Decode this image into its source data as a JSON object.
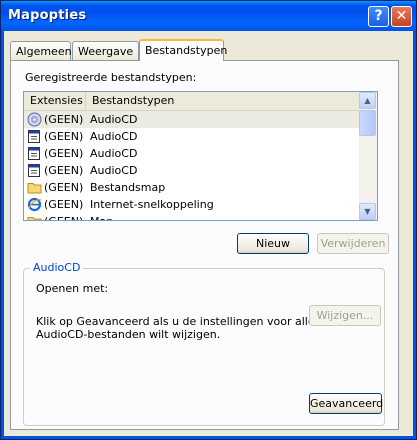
{
  "window": {
    "title": "Mapopties"
  },
  "tabs": [
    {
      "label": "Algemeen"
    },
    {
      "label": "Weergave"
    },
    {
      "label": "Bestandstypen"
    }
  ],
  "registered_label": "Geregistreerde bestandstypen:",
  "columns": [
    {
      "label": "Extensies"
    },
    {
      "label": "Bestandstypen"
    }
  ],
  "rows": [
    {
      "ext": "(GEEN)",
      "type": "AudioCD",
      "icon": "audio-cd-icon",
      "selected": true
    },
    {
      "ext": "(GEEN)",
      "type": "AudioCD",
      "icon": "app-window-icon"
    },
    {
      "ext": "(GEEN)",
      "type": "AudioCD",
      "icon": "app-window-icon"
    },
    {
      "ext": "(GEEN)",
      "type": "AudioCD",
      "icon": "app-window-icon"
    },
    {
      "ext": "(GEEN)",
      "type": "Bestandsmap",
      "icon": "folder-icon"
    },
    {
      "ext": "(GEEN)",
      "type": "Internet-snelkoppeling",
      "icon": "internet-explorer-icon"
    },
    {
      "ext": "(GEEN)",
      "type": "Map",
      "icon": "folder-icon"
    }
  ],
  "buttons": {
    "new": "Nieuw",
    "delete": "Verwijderen",
    "change": "Wijzigen...",
    "advanced": "Geavanceerd"
  },
  "details": {
    "group_title": "AudioCD",
    "open_with": "Openen met:",
    "info_line1": "Klik op Geavanceerd als u de instellingen voor alle",
    "info_line2": "AudioCD-bestanden wilt wijzigen."
  },
  "colors": {
    "title_bar": "#0054e3",
    "group_title": "#0046d5",
    "face": "#ece9d8"
  }
}
